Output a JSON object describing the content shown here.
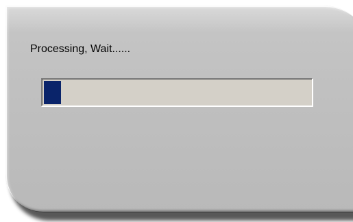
{
  "dialog": {
    "status_text": "Processing, Wait......"
  },
  "progress": {
    "value_fraction": 0.065,
    "fill_color": "#0a246a",
    "track_color": "#d4d0c8"
  }
}
